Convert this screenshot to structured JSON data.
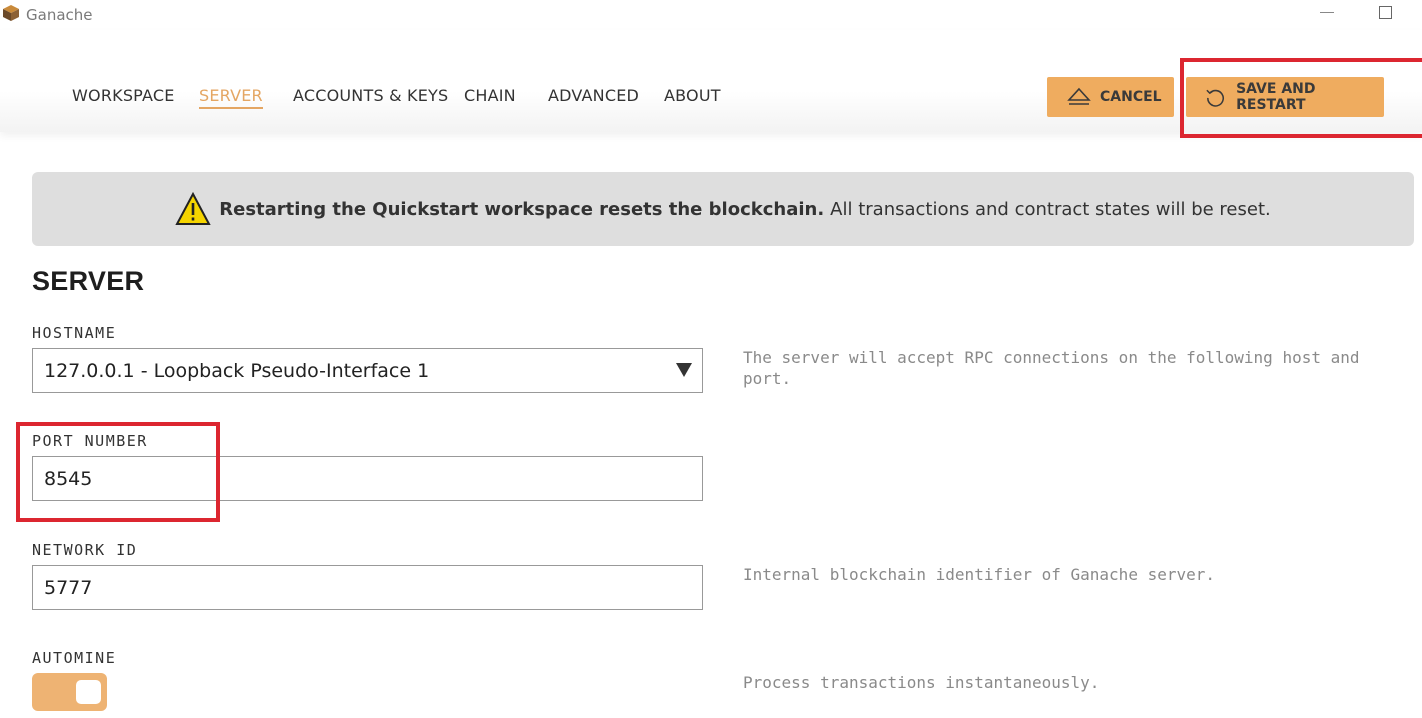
{
  "window": {
    "title": "Ganache"
  },
  "nav": {
    "tabs": [
      "WORKSPACE",
      "SERVER",
      "ACCOUNTS & KEYS",
      "CHAIN",
      "ADVANCED",
      "ABOUT"
    ],
    "active": "SERVER"
  },
  "actions": {
    "cancel_label": "CANCEL",
    "save_label": "SAVE AND RESTART"
  },
  "warning": {
    "bold": "Restarting the Quickstart workspace resets the blockchain.",
    "text": "All transactions and contract states will be reset."
  },
  "server": {
    "title": "SERVER",
    "hostname": {
      "label": "HOSTNAME",
      "value": "127.0.0.1 - Loopback Pseudo-Interface 1",
      "help": "The server will accept RPC connections on the following host and port."
    },
    "port": {
      "label": "PORT NUMBER",
      "value": "8545"
    },
    "network_id": {
      "label": "NETWORK ID",
      "value": "5777",
      "help": "Internal blockchain identifier of Ganache server."
    },
    "automine": {
      "label": "AUTOMINE",
      "enabled": true,
      "help": "Process transactions instantaneously."
    }
  },
  "colors": {
    "accent": "#efac5f",
    "highlight": "#dc2630",
    "warning_bg": "#dedede"
  },
  "icons": {
    "logo": "ganache-logo-icon",
    "cancel": "eject-icon",
    "save": "restart-icon",
    "warning": "warning-icon"
  }
}
